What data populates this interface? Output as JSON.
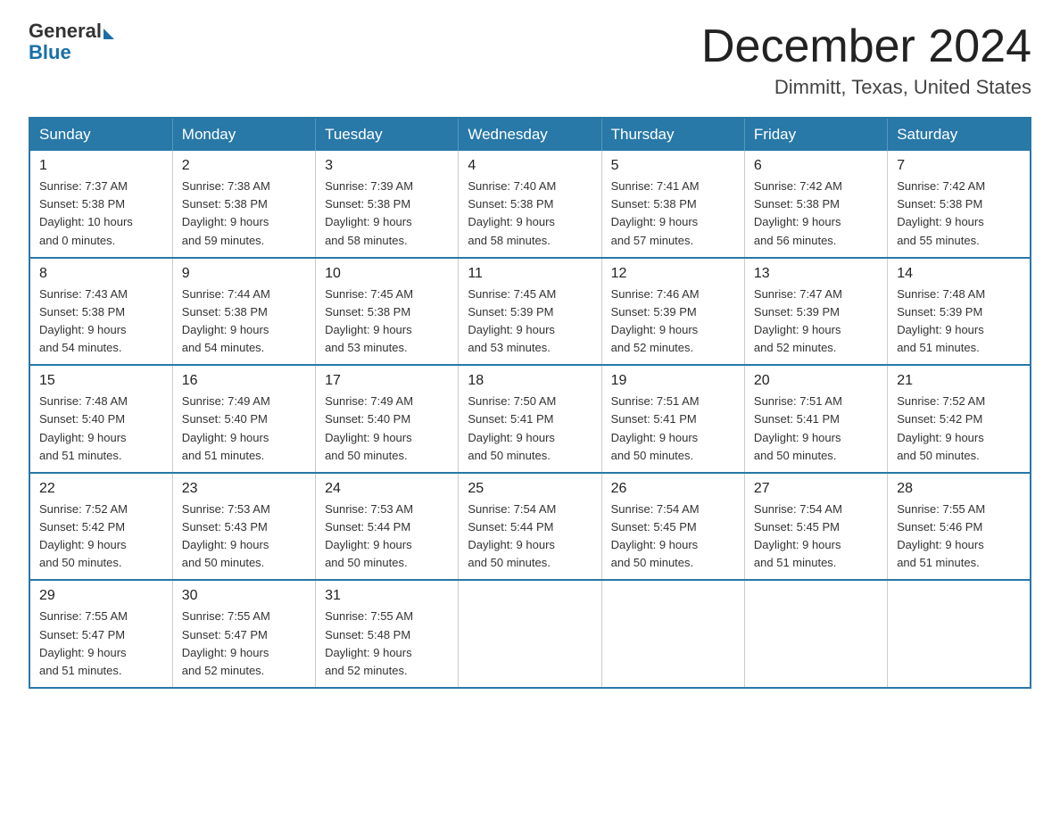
{
  "logo": {
    "general": "General",
    "blue": "Blue"
  },
  "header": {
    "month": "December 2024",
    "location": "Dimmitt, Texas, United States"
  },
  "weekdays": [
    "Sunday",
    "Monday",
    "Tuesday",
    "Wednesday",
    "Thursday",
    "Friday",
    "Saturday"
  ],
  "weeks": [
    [
      {
        "day": "1",
        "sunrise": "7:37 AM",
        "sunset": "5:38 PM",
        "daylight": "10 hours and 0 minutes."
      },
      {
        "day": "2",
        "sunrise": "7:38 AM",
        "sunset": "5:38 PM",
        "daylight": "9 hours and 59 minutes."
      },
      {
        "day": "3",
        "sunrise": "7:39 AM",
        "sunset": "5:38 PM",
        "daylight": "9 hours and 58 minutes."
      },
      {
        "day": "4",
        "sunrise": "7:40 AM",
        "sunset": "5:38 PM",
        "daylight": "9 hours and 58 minutes."
      },
      {
        "day": "5",
        "sunrise": "7:41 AM",
        "sunset": "5:38 PM",
        "daylight": "9 hours and 57 minutes."
      },
      {
        "day": "6",
        "sunrise": "7:42 AM",
        "sunset": "5:38 PM",
        "daylight": "9 hours and 56 minutes."
      },
      {
        "day": "7",
        "sunrise": "7:42 AM",
        "sunset": "5:38 PM",
        "daylight": "9 hours and 55 minutes."
      }
    ],
    [
      {
        "day": "8",
        "sunrise": "7:43 AM",
        "sunset": "5:38 PM",
        "daylight": "9 hours and 54 minutes."
      },
      {
        "day": "9",
        "sunrise": "7:44 AM",
        "sunset": "5:38 PM",
        "daylight": "9 hours and 54 minutes."
      },
      {
        "day": "10",
        "sunrise": "7:45 AM",
        "sunset": "5:38 PM",
        "daylight": "9 hours and 53 minutes."
      },
      {
        "day": "11",
        "sunrise": "7:45 AM",
        "sunset": "5:39 PM",
        "daylight": "9 hours and 53 minutes."
      },
      {
        "day": "12",
        "sunrise": "7:46 AM",
        "sunset": "5:39 PM",
        "daylight": "9 hours and 52 minutes."
      },
      {
        "day": "13",
        "sunrise": "7:47 AM",
        "sunset": "5:39 PM",
        "daylight": "9 hours and 52 minutes."
      },
      {
        "day": "14",
        "sunrise": "7:48 AM",
        "sunset": "5:39 PM",
        "daylight": "9 hours and 51 minutes."
      }
    ],
    [
      {
        "day": "15",
        "sunrise": "7:48 AM",
        "sunset": "5:40 PM",
        "daylight": "9 hours and 51 minutes."
      },
      {
        "day": "16",
        "sunrise": "7:49 AM",
        "sunset": "5:40 PM",
        "daylight": "9 hours and 51 minutes."
      },
      {
        "day": "17",
        "sunrise": "7:49 AM",
        "sunset": "5:40 PM",
        "daylight": "9 hours and 50 minutes."
      },
      {
        "day": "18",
        "sunrise": "7:50 AM",
        "sunset": "5:41 PM",
        "daylight": "9 hours and 50 minutes."
      },
      {
        "day": "19",
        "sunrise": "7:51 AM",
        "sunset": "5:41 PM",
        "daylight": "9 hours and 50 minutes."
      },
      {
        "day": "20",
        "sunrise": "7:51 AM",
        "sunset": "5:41 PM",
        "daylight": "9 hours and 50 minutes."
      },
      {
        "day": "21",
        "sunrise": "7:52 AM",
        "sunset": "5:42 PM",
        "daylight": "9 hours and 50 minutes."
      }
    ],
    [
      {
        "day": "22",
        "sunrise": "7:52 AM",
        "sunset": "5:42 PM",
        "daylight": "9 hours and 50 minutes."
      },
      {
        "day": "23",
        "sunrise": "7:53 AM",
        "sunset": "5:43 PM",
        "daylight": "9 hours and 50 minutes."
      },
      {
        "day": "24",
        "sunrise": "7:53 AM",
        "sunset": "5:44 PM",
        "daylight": "9 hours and 50 minutes."
      },
      {
        "day": "25",
        "sunrise": "7:54 AM",
        "sunset": "5:44 PM",
        "daylight": "9 hours and 50 minutes."
      },
      {
        "day": "26",
        "sunrise": "7:54 AM",
        "sunset": "5:45 PM",
        "daylight": "9 hours and 50 minutes."
      },
      {
        "day": "27",
        "sunrise": "7:54 AM",
        "sunset": "5:45 PM",
        "daylight": "9 hours and 51 minutes."
      },
      {
        "day": "28",
        "sunrise": "7:55 AM",
        "sunset": "5:46 PM",
        "daylight": "9 hours and 51 minutes."
      }
    ],
    [
      {
        "day": "29",
        "sunrise": "7:55 AM",
        "sunset": "5:47 PM",
        "daylight": "9 hours and 51 minutes."
      },
      {
        "day": "30",
        "sunrise": "7:55 AM",
        "sunset": "5:47 PM",
        "daylight": "9 hours and 52 minutes."
      },
      {
        "day": "31",
        "sunrise": "7:55 AM",
        "sunset": "5:48 PM",
        "daylight": "9 hours and 52 minutes."
      },
      null,
      null,
      null,
      null
    ]
  ],
  "labels": {
    "sunrise": "Sunrise: ",
    "sunset": "Sunset: ",
    "daylight": "Daylight: "
  }
}
